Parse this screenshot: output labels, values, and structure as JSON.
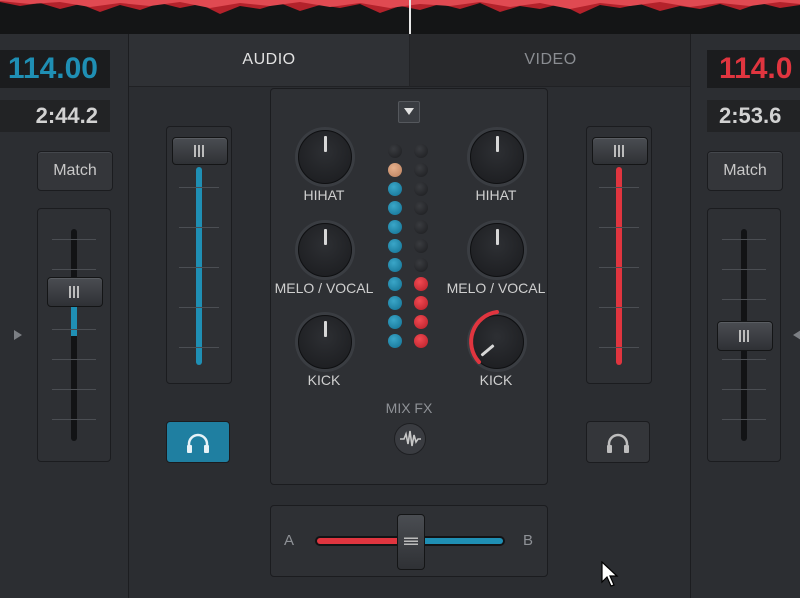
{
  "colors": {
    "deck_a_accent": "#1f8fb4",
    "deck_b_accent": "#e0353f",
    "panel": "#2e3034",
    "background": "#2a2c30"
  },
  "deck_a": {
    "bpm": "114.00",
    "time": "2:44.2",
    "match_label": "Match",
    "pitch_value": 0.3,
    "volume_level": 0.92,
    "headphone_active": true
  },
  "deck_b": {
    "bpm": "114.0",
    "time": "2:53.6",
    "match_label": "Match",
    "pitch_value": 0.5,
    "volume_level": 0.92,
    "headphone_active": false
  },
  "tabs": [
    {
      "label": "AUDIO",
      "active": true
    },
    {
      "label": "VIDEO",
      "active": false
    }
  ],
  "eq": {
    "left": [
      {
        "label": "HIHAT"
      },
      {
        "label": "MELO / VOCAL"
      },
      {
        "label": "KICK"
      }
    ],
    "right": [
      {
        "label": "HIHAT"
      },
      {
        "label": "MELO / VOCAL"
      },
      {
        "label": "KICK"
      }
    ],
    "mixfx_label": "MIX FX"
  },
  "meters": {
    "left_lit": 10,
    "right_lit": 4,
    "segments": 11
  },
  "crossfader": {
    "left_label": "A",
    "right_label": "B",
    "position": 0.5
  },
  "icons": {
    "headphones": "headphones-icon",
    "mixfx": "waveform-icon",
    "dropdown": "triangle-down-icon",
    "cursor": "mouse-cursor-icon"
  }
}
